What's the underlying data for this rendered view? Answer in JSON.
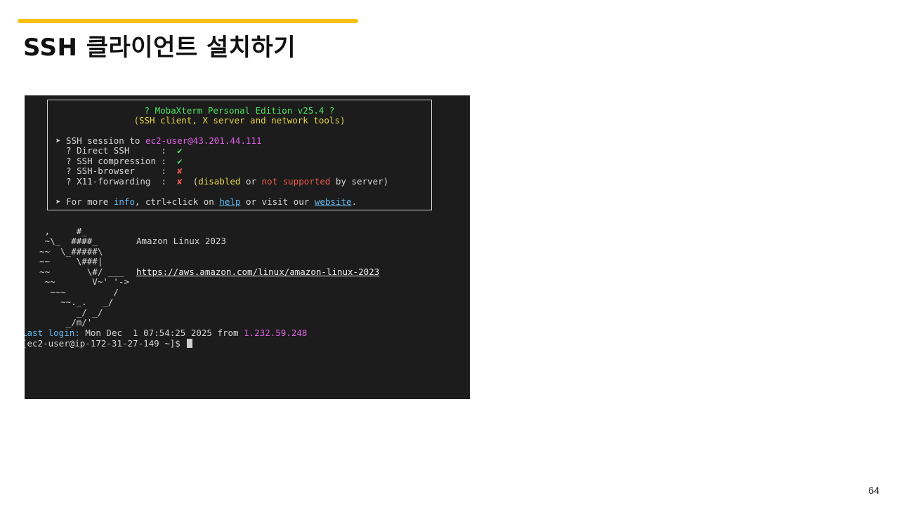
{
  "slide": {
    "title": "SSH 클라이언트 설치하기",
    "page_number": "64"
  },
  "colors": {
    "accent": "#f9c00f",
    "terminal_bg": "#1c1c1c",
    "green": "#4ee35f",
    "yellow": "#e6d64a",
    "magenta": "#e05fe6",
    "red": "#ef5a4a",
    "blue": "#63b7ef"
  },
  "terminal": {
    "banner": {
      "product": "? MobaXterm Personal Edition v25.4 ?",
      "subtitle": "(SSH client, X server and network tools)",
      "session_prefix": "➤ SSH session to ",
      "session_target": "ec2-user@43.201.44.111",
      "features": [
        {
          "label": "  ? Direct SSH      :  ",
          "status": "✔",
          "status_icon": "check-icon"
        },
        {
          "label": "  ? SSH compression :  ",
          "status": "✔",
          "status_icon": "check-icon"
        },
        {
          "label": "  ? SSH-browser     :  ",
          "status": "✘",
          "status_icon": "cross-icon"
        },
        {
          "label": "  ? X11-forwarding  :  ",
          "status": "✘",
          "status_icon": "cross-icon"
        }
      ],
      "x11_note_open": "  (",
      "x11_note_disabled": "disabled",
      "x11_note_or": " or ",
      "x11_note_not_supported": "not supported",
      "x11_note_close": " by server)",
      "more_prefix": "➤ For more ",
      "more_info": "info",
      "more_mid": ", ctrl+click on ",
      "more_help": "help",
      "more_visit": " or visit our ",
      "more_website": "website",
      "more_end": "."
    },
    "ascii_art": [
      "   ,     #_",
      "   ~\\_  ####_",
      "  ~~  \\_#####\\",
      "  ~~     \\###|",
      "  ~~       \\#/ ___",
      "   ~~       V~' '->",
      "    ~~~         /",
      "      ~~._.   _/",
      "         _/ _/",
      "       _/m/'"
    ],
    "os_name": "Amazon Linux 2023",
    "os_url": "https://aws.amazon.com/linux/amazon-linux-2023",
    "last_login_label": "Last login:",
    "last_login_value": " Mon Dec  1 07:54:25 2025 from ",
    "last_login_ip": "1.232.59.248",
    "prompt": "[ec2-user@ip-172-31-27-149 ~]$ "
  }
}
